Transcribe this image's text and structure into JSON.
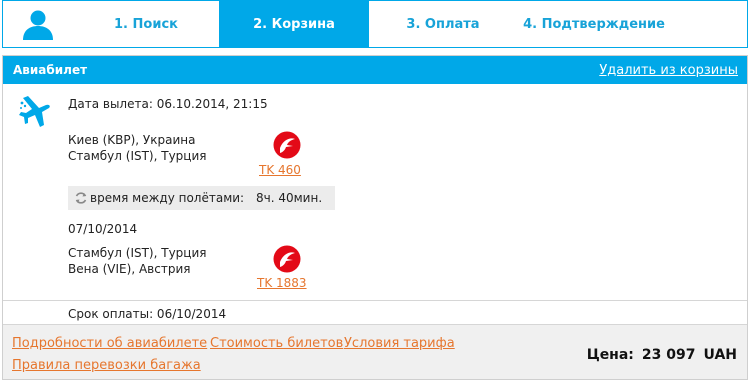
{
  "steps": [
    {
      "label": "1. Поиск"
    },
    {
      "label": "2. Корзина"
    },
    {
      "label": "3. Оплата"
    },
    {
      "label": "4. Подтверждение"
    }
  ],
  "ticket": {
    "title": "Авиабилет",
    "remove_link": "Удалить из корзины",
    "departure": "Дата вылета:  06.10.2014, 21:15",
    "segment1": {
      "from": "Киев (KBP), Украина",
      "to": "Стамбул (IST), Турция",
      "flight": "TK 460"
    },
    "layover": {
      "label": "время между полётами:",
      "duration": "8ч. 40мин."
    },
    "segment2": {
      "date": "07/10/2014",
      "from": "Стамбул (IST), Турция",
      "to": "Вена (VIE), Австрия",
      "flight": "TK 1883"
    },
    "payment_deadline": "Срок оплаты: 06/10/2014"
  },
  "footer": {
    "links": [
      "Подробности об авиабилете",
      "Стоимость билетов",
      "Условия тарифа",
      "Правила перевозки багажа"
    ],
    "price_label": "Цена:",
    "price_value": "23 097",
    "currency": "UAH"
  },
  "colors": {
    "accent": "#00a8e8",
    "link": "#e6762e",
    "airline_red": "#e30a17"
  },
  "icons": {
    "user": "user-icon",
    "plane": "plane-icon",
    "airline": "turkish-airlines-logo",
    "refresh": "refresh-icon"
  }
}
